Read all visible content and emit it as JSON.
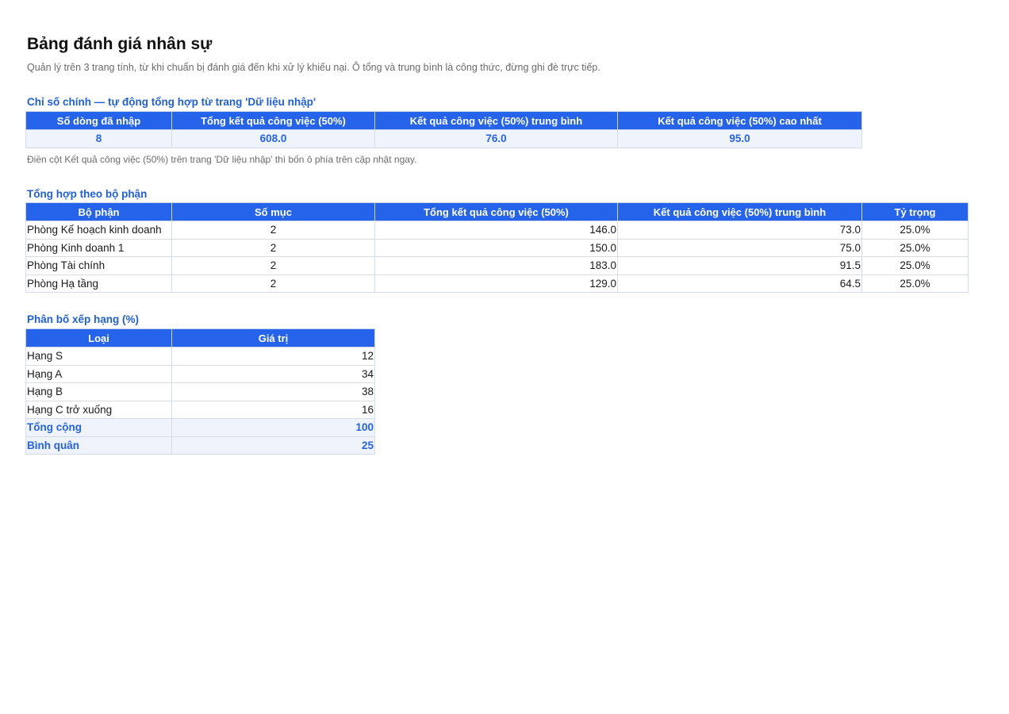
{
  "title": "Bảng đánh giá nhân sự",
  "description": "Quản lý trên 3 trang tính, từ khi chuẩn bị đánh giá đến khi xử lý khiếu nại. Ô tổng và trung bình là công thức, đừng ghi đè trực tiếp.",
  "kpi": {
    "section_title": "Chỉ số chính — tự động tổng hợp từ trang 'Dữ liệu nhập'",
    "headers": [
      "Số dòng đã nhập",
      "Tổng kết quả công việc (50%)",
      "Kết quả công việc (50%) trung bình",
      "Kết quả công việc (50%) cao nhất"
    ],
    "values": [
      "8",
      "608.0",
      "76.0",
      "95.0"
    ],
    "note": "Điền cột Kết quả công việc (50%) trên trang 'Dữ liệu nhập' thì bốn ô phía trên cập nhật ngay."
  },
  "department_summary": {
    "section_title": "Tổng hợp theo bộ phận",
    "headers": [
      "Bộ phận",
      "Số mục",
      "Tổng kết quả công việc (50%)",
      "Kết quả công việc (50%) trung bình",
      "Tỷ trọng"
    ],
    "rows": [
      [
        "Phòng Kế hoạch kinh doanh",
        "2",
        "146.0",
        "73.0",
        "25.0%"
      ],
      [
        "Phòng Kinh doanh 1",
        "2",
        "150.0",
        "75.0",
        "25.0%"
      ],
      [
        "Phòng Tài chính",
        "2",
        "183.0",
        "91.5",
        "25.0%"
      ],
      [
        "Phòng Hạ tầng",
        "2",
        "129.0",
        "64.5",
        "25.0%"
      ]
    ]
  },
  "rating_distribution": {
    "section_title": "Phân bố xếp hạng (%)",
    "headers": [
      "Loại",
      "Giá trị"
    ],
    "rows": [
      [
        "Hạng S",
        "12"
      ],
      [
        "Hạng A",
        "34"
      ],
      [
        "Hạng B",
        "38"
      ],
      [
        "Hạng C trở xuống",
        "16"
      ]
    ],
    "total": [
      "Tổng cộng",
      "100"
    ],
    "average": [
      "Bình quân",
      "25"
    ]
  }
}
